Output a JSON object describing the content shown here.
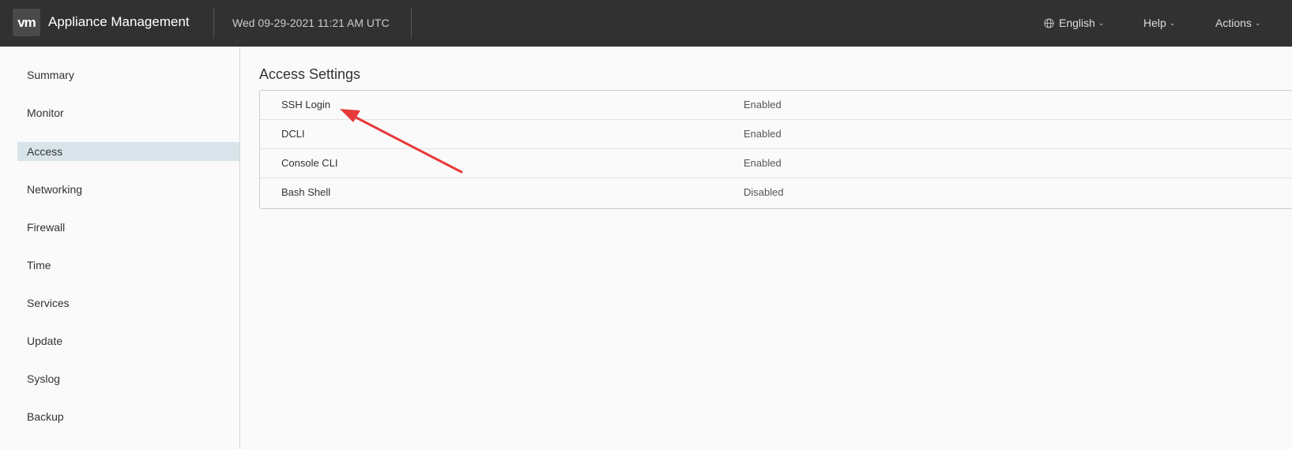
{
  "header": {
    "logo_text": "vm",
    "app_title": "Appliance Management",
    "datetime": "Wed 09-29-2021 11:21 AM UTC",
    "nav": {
      "language": "English",
      "help": "Help",
      "actions": "Actions"
    },
    "icons": [
      "globe-icon",
      "chevron-down-icon"
    ]
  },
  "sidebar": {
    "items": [
      {
        "label": "Summary",
        "active": false
      },
      {
        "label": "Monitor",
        "active": false
      },
      {
        "label": "Access",
        "active": true
      },
      {
        "label": "Networking",
        "active": false
      },
      {
        "label": "Firewall",
        "active": false
      },
      {
        "label": "Time",
        "active": false
      },
      {
        "label": "Services",
        "active": false
      },
      {
        "label": "Update",
        "active": false
      },
      {
        "label": "Syslog",
        "active": false
      },
      {
        "label": "Backup",
        "active": false
      }
    ]
  },
  "main": {
    "title": "Access Settings",
    "settings": [
      {
        "label": "SSH Login",
        "value": "Enabled"
      },
      {
        "label": "DCLI",
        "value": "Enabled"
      },
      {
        "label": "Console CLI",
        "value": "Enabled"
      },
      {
        "label": "Bash Shell",
        "value": "Disabled"
      }
    ]
  },
  "colors": {
    "header_bg": "#313131",
    "active_item_bg": "#d9e4ea",
    "annotation_arrow": "#e83a3a"
  }
}
